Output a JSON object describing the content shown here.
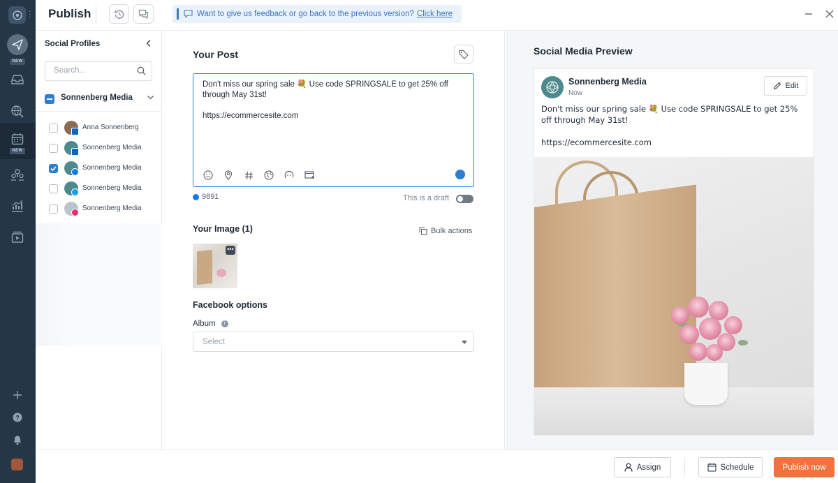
{
  "app": {
    "title": "Publish",
    "feedback_text": "Want to give us feedback or go back to the previous version?",
    "feedback_link": "Click here"
  },
  "rail": {
    "badges": [
      "NEW",
      "NEW"
    ]
  },
  "profiles": {
    "title": "Social Profiles",
    "search_placeholder": "Search...",
    "group_name": "Sonnenberg Media",
    "items": [
      {
        "name": "Anna Sonnenberg",
        "network": "linkedin",
        "checked": false
      },
      {
        "name": "Sonnenberg Media",
        "network": "linkedin",
        "checked": false
      },
      {
        "name": "Sonnenberg Media",
        "network": "facebook",
        "checked": true
      },
      {
        "name": "Sonnenberg Media",
        "network": "twitter",
        "checked": false
      },
      {
        "name": "Sonnenberg Media",
        "network": "instagram",
        "checked": false
      }
    ]
  },
  "editor": {
    "title": "Your Post",
    "post_text": "Don't miss our spring sale 💐 Use code SPRINGSALE to get 25% off through May 31st!\n\nhttps://ecommercesite.com",
    "char_count": "9891",
    "draft_label": "This is a draft",
    "image_heading": "Your Image (1)",
    "bulk_actions": "Bulk actions",
    "fb_options": "Facebook options",
    "album_label": "Album",
    "album_placeholder": "Select"
  },
  "preview": {
    "title": "Social Media Preview",
    "page_name": "Sonnenberg Media",
    "time": "Now",
    "edit_label": "Edit",
    "post_text": "Don't miss our spring sale 💐 Use code SPRINGSALE to get 25% off through May 31st!\n\nhttps://ecommercesite.com"
  },
  "footer": {
    "assign": "Assign",
    "schedule": "Schedule",
    "publish": "Publish now"
  },
  "colors": {
    "accent": "#2f7cd3",
    "publish": "#f0733f",
    "rail": "#253646",
    "linkedin": "#0a66c2",
    "facebook": "#1877f2",
    "twitter": "#1d9bf0",
    "instagram": "#e1306c"
  }
}
